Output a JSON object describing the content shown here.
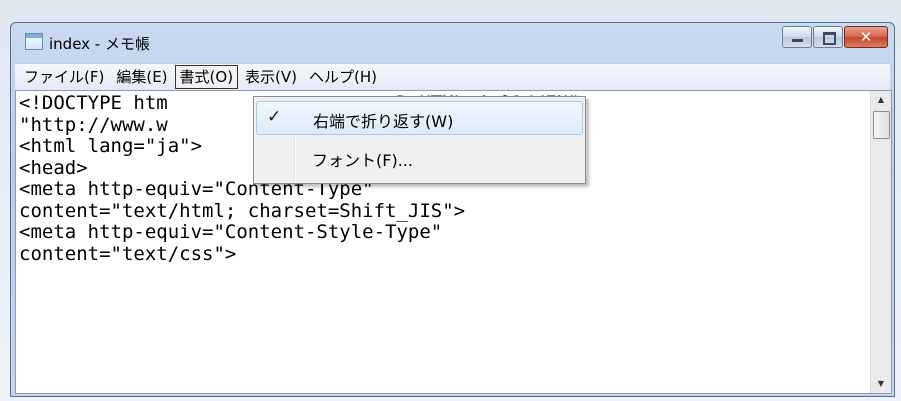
{
  "window": {
    "title": "index - メモ帳",
    "close_glyph": "✕"
  },
  "menubar": {
    "items": [
      {
        "label": "ファイル(F)"
      },
      {
        "label": "編集(E)"
      },
      {
        "label": "書式(O)",
        "open": true
      },
      {
        "label": "表示(V)"
      },
      {
        "label": "ヘルプ(H)"
      }
    ]
  },
  "format_menu": {
    "items": [
      {
        "label": "右端で折り返す(W)",
        "checked": true,
        "check_glyph": "✓"
      },
      {
        "label": "フォント(F)..."
      }
    ]
  },
  "editor": {
    "lines": [
      "<!DOCTYPE htm                    D HTML 4.01//EN\"",
      "\"http://www.w                    t.dtd\">",
      "<html lang=\"ja\">",
      "<head>",
      "<meta http-equiv=\"Content-Type\"",
      "content=\"text/html; charset=Shift_JIS\">",
      "<meta http-equiv=\"Content-Style-Type\"",
      "content=\"text/css\">"
    ]
  },
  "scrollbar": {
    "up_glyph": "▲",
    "down_glyph": "▼"
  },
  "colors": {
    "titlebar": "#c9daf0",
    "close_button": "#c2462c",
    "menu_highlight": "#dceaf9"
  }
}
